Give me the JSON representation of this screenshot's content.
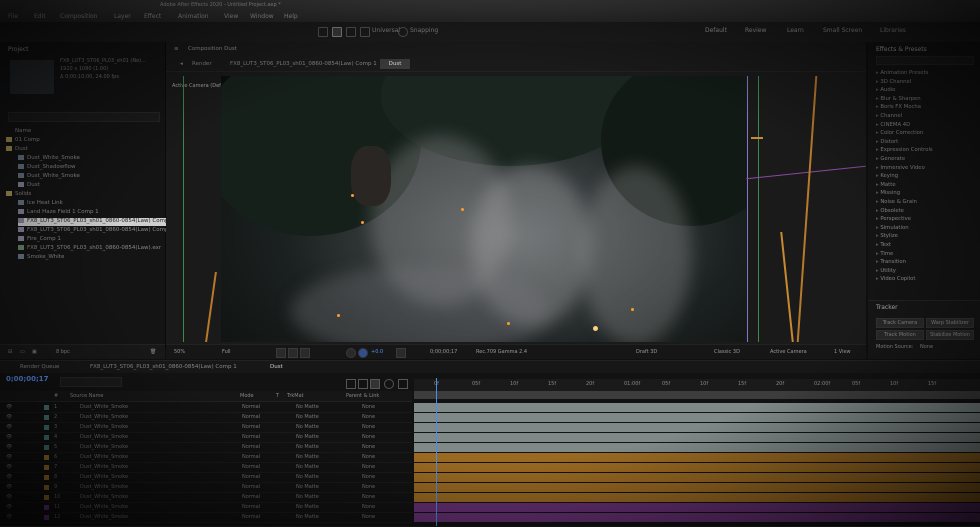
{
  "window": {
    "title": "Adobe After Effects 2020 - Untitled Project.aep *",
    "menu": [
      "File",
      "Edit",
      "Composition",
      "Layer",
      "Effect",
      "Animation",
      "View",
      "Window",
      "Help"
    ]
  },
  "toolbar": {
    "snapping_label": "Snapping",
    "universal_label": "Universal",
    "workspaces": [
      "Default",
      "Review",
      "Learn",
      "Small Screen",
      "Libraries"
    ]
  },
  "project": {
    "header": "Project",
    "meta": [
      "FX8_LUT3_ST06_PL03_sh01 (Ne)...",
      "1920 x 1080 (1.00)",
      "Δ 0;00;10;00, 24.00 fps"
    ],
    "rows": [
      {
        "label": "Name",
        "type": "header"
      },
      {
        "label": "01 Comp",
        "type": "folder"
      },
      {
        "label": "Dust",
        "type": "folder"
      },
      {
        "label": "Dust_White_Smoke",
        "type": "item"
      },
      {
        "label": "Dust_Shadowflow",
        "type": "item"
      },
      {
        "label": "Dust_White_Smoke",
        "type": "item"
      },
      {
        "label": "Dust",
        "type": "comp"
      },
      {
        "label": "Solids",
        "type": "folder"
      },
      {
        "label": "Ice Heat Link",
        "type": "item"
      },
      {
        "label": "Land Haze Field 1 Comp 1",
        "type": "comp"
      },
      {
        "label": "FX8_LUT3_ST06_PL03_sh01_0860-0854(Law) Comp 1",
        "type": "comp",
        "selected": true
      },
      {
        "label": "FX8_LUT3_ST06_PL03_sh01_0860-0854(Law) Comp 1",
        "type": "comp"
      },
      {
        "label": "Fire_Comp 1",
        "type": "comp"
      },
      {
        "label": "FX8_LUT3_ST06_PL03_sh01_0860-0854(Law).exr",
        "type": "footage"
      },
      {
        "label": "Smoke_White",
        "type": "item"
      }
    ],
    "footer": {
      "bpc": "8 bpc"
    }
  },
  "viewer": {
    "panel_title": "Composition Dust",
    "flow_crumb": "FX8_LUT3_ST06_PL03_sh01_0860-0854(Law) Comp 1",
    "flow_active": "Dust",
    "render_label": "Render",
    "camera": "Active Camera (Default)",
    "controls": {
      "zoom": "50%",
      "resolution": "Full",
      "timecode": "0;00;00;17",
      "renderer": "Classic 3D",
      "view": "Active Camera",
      "views": "1 View",
      "exposure": "+0.0",
      "draft": "Draft 3D",
      "colorspace": "Rec.709 Gamma 2.4"
    }
  },
  "effects": {
    "title": "Effects & Presets",
    "items": [
      "Animation Presets",
      "3D Channel",
      "Audio",
      "Blur & Sharpen",
      "Boris FX Mocha",
      "Channel",
      "CINEMA 4D",
      "Color Correction",
      "Distort",
      "Expression Controls",
      "Generate",
      "Immersive Video",
      "Keying",
      "Matte",
      "Missing",
      "Noise & Grain",
      "Obsolete",
      "Perspective",
      "Simulation",
      "Stylize",
      "Text",
      "Time",
      "Transition",
      "Utility",
      "Video Copilot"
    ]
  },
  "tracker": {
    "title": "Tracker",
    "buttons": [
      "Track Camera",
      "Warp Stabilizer",
      "Track Motion",
      "Stabilize Motion"
    ],
    "motion_source_label": "Motion Source:",
    "motion_source": "None"
  },
  "timeline": {
    "tabs": [
      "Render Queue",
      "FX8_LUT3_ST06_PL03_sh01_0860-0854(Law) Comp 1",
      "Dust"
    ],
    "timecode": "0;00;00;17",
    "columns": [
      "#",
      "Source Name",
      "Mode",
      "T",
      "TrkMat",
      "Parent & Link"
    ],
    "layers": [
      {
        "num": "1",
        "name": "Dust_White_Smoke",
        "mode": "Normal",
        "trkmat": "No Matte",
        "parent": "None",
        "color": "#4a7a7a"
      },
      {
        "num": "2",
        "name": "Dust_White_Smoke",
        "mode": "Normal",
        "trkmat": "No Matte",
        "parent": "None",
        "color": "#4a7a7a"
      },
      {
        "num": "3",
        "name": "Dust_White_Smoke",
        "mode": "Normal",
        "trkmat": "No Matte",
        "parent": "None",
        "color": "#4a7a7a"
      },
      {
        "num": "4",
        "name": "Dust_White_Smoke",
        "mode": "Normal",
        "trkmat": "No Matte",
        "parent": "None",
        "color": "#4a7a7a"
      },
      {
        "num": "5",
        "name": "Dust_White_Smoke",
        "mode": "Normal",
        "trkmat": "No Matte",
        "parent": "None",
        "color": "#4a7a7a"
      },
      {
        "num": "6",
        "name": "Dust_White_Smoke",
        "mode": "Normal",
        "trkmat": "No Matte",
        "parent": "None",
        "color": "#a87830"
      },
      {
        "num": "7",
        "name": "Dust_White_Smoke",
        "mode": "Normal",
        "trkmat": "No Matte",
        "parent": "None",
        "color": "#a87830"
      },
      {
        "num": "8",
        "name": "Dust_White_Smoke",
        "mode": "Normal",
        "trkmat": "No Matte",
        "parent": "None",
        "color": "#a87830"
      },
      {
        "num": "9",
        "name": "Dust_White_Smoke",
        "mode": "Normal",
        "trkmat": "No Matte",
        "parent": "None",
        "color": "#a87830"
      },
      {
        "num": "10",
        "name": "Dust_White_Smoke",
        "mode": "Normal",
        "trkmat": "No Matte",
        "parent": "None",
        "color": "#a87830"
      },
      {
        "num": "11",
        "name": "Dust_White_Smoke",
        "mode": "Normal",
        "trkmat": "No Matte",
        "parent": "None",
        "color": "#7a3a9a"
      },
      {
        "num": "12",
        "name": "Dust_White_Smoke",
        "mode": "Normal",
        "trkmat": "No Matte",
        "parent": "None",
        "color": "#7a3a9a"
      }
    ],
    "ruler": [
      "0f",
      "05f",
      "10f",
      "15f",
      "20f",
      "01:00f",
      "05f",
      "10f",
      "15f",
      "20f",
      "02:00f",
      "05f",
      "10f",
      "15f"
    ],
    "track_colors": [
      "#7f8a88",
      "#7f8a88",
      "#7f8a88",
      "#7f8a88",
      "#7f8a88",
      "#9a6a22",
      "#9a6a22",
      "#9a6a22",
      "#9a6a22",
      "#9a6a22",
      "#6a3278",
      "#6a3278"
    ]
  }
}
